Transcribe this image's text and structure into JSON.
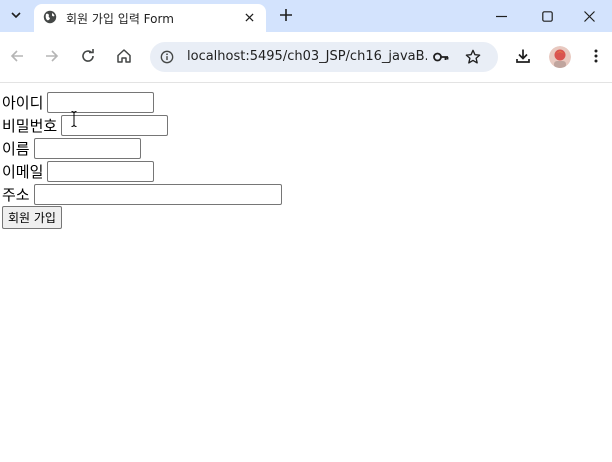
{
  "browser": {
    "tab_title": "회원 가입 입력 Form",
    "url": "localhost:5495/ch03_JSP/ch16_javaB..."
  },
  "form": {
    "fields": [
      {
        "label": "아이디",
        "value": ""
      },
      {
        "label": "비밀번호",
        "value": ""
      },
      {
        "label": "이름",
        "value": ""
      },
      {
        "label": "이메일",
        "value": ""
      },
      {
        "label": "주소",
        "value": ""
      }
    ],
    "submit_label": "회원 가입"
  },
  "colors": {
    "tabstrip_bg": "#d3e3fd",
    "omnibox_bg": "#e9eef6"
  }
}
